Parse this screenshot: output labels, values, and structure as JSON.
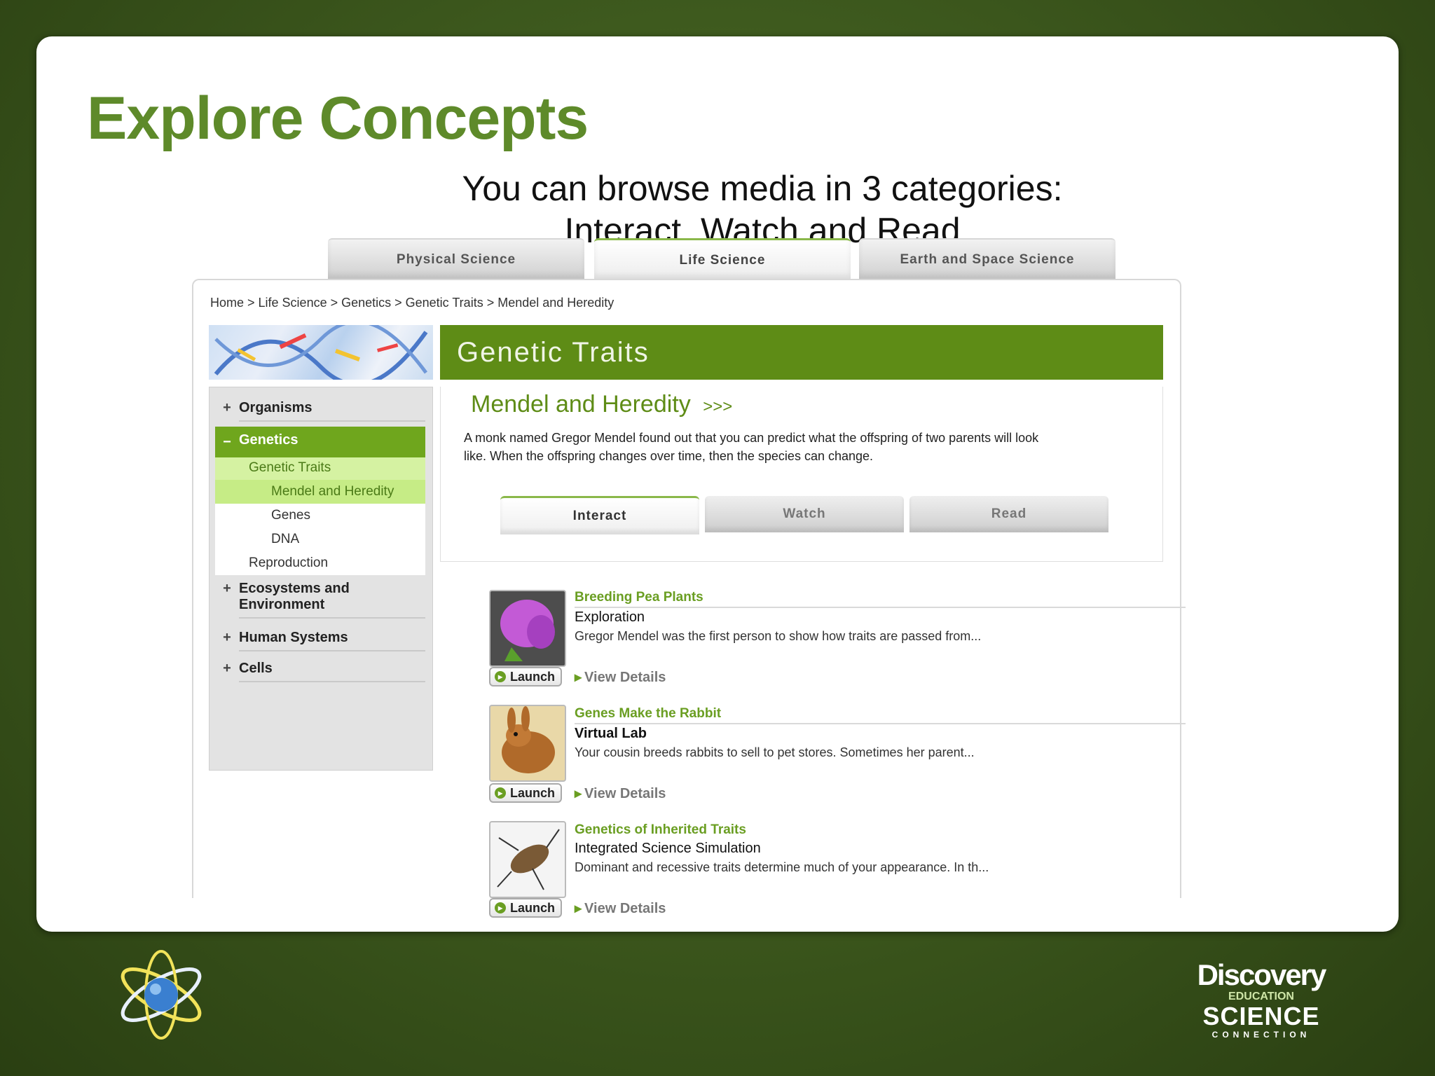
{
  "slide": {
    "title": "Explore Concepts",
    "subtitle_line1": "You can browse media in 3 categories:",
    "subtitle_line2": "Interact, Watch and Read"
  },
  "topic_tabs": [
    "Physical Science",
    "Life Science",
    "Earth and Space Science"
  ],
  "breadcrumb": "Home > Life Science > Genetics > Genetic Traits > Mendel and Heredity",
  "page_header": "Genetic Traits",
  "sidebar": {
    "organisms": "Organisms",
    "genetics": "Genetics",
    "genetic_traits": "Genetic Traits",
    "mendel": "Mendel and Heredity",
    "genes": "Genes",
    "dna": "DNA",
    "reproduction": "Reproduction",
    "ecosystems_line1": "Ecosystems and",
    "ecosystems_line2": "Environment",
    "human_systems": "Human Systems",
    "cells": "Cells"
  },
  "section": {
    "title": "Mendel and Heredity",
    "arrows": ">>>",
    "desc_line1": "A monk named Gregor Mendel found out that you can predict what the offspring of two parents will look",
    "desc_line2": "like. When the offspring changes over time, then the species can change."
  },
  "media_tabs": [
    "Interact",
    "Watch",
    "Read"
  ],
  "items": [
    {
      "title": "Breeding Pea Plants",
      "type": "Exploration",
      "desc": "Gregor Mendel was the first person to show how traits are passed from...",
      "launch": "Launch",
      "details": "View Details"
    },
    {
      "title": "Genes Make the Rabbit",
      "type": "Virtual Lab",
      "desc": "Your cousin breeds rabbits to sell to pet stores. Sometimes her parent...",
      "launch": "Launch",
      "details": "View Details"
    },
    {
      "title": "Genetics of Inherited Traits",
      "type": "Integrated Science Simulation",
      "desc": "Dominant and recessive traits determine much of your appearance. In th...",
      "launch": "Launch",
      "details": "View Details"
    }
  ],
  "logo": {
    "line1": "Discovery",
    "line2": "EDUCATION",
    "line3": "SCIENCE",
    "line4": "CONNECTION"
  },
  "colors": {
    "title_green": "#5e8a2a",
    "header_green": "#5e8c16",
    "nav_active": "#6fa61d",
    "link_green": "#6a9e22"
  }
}
